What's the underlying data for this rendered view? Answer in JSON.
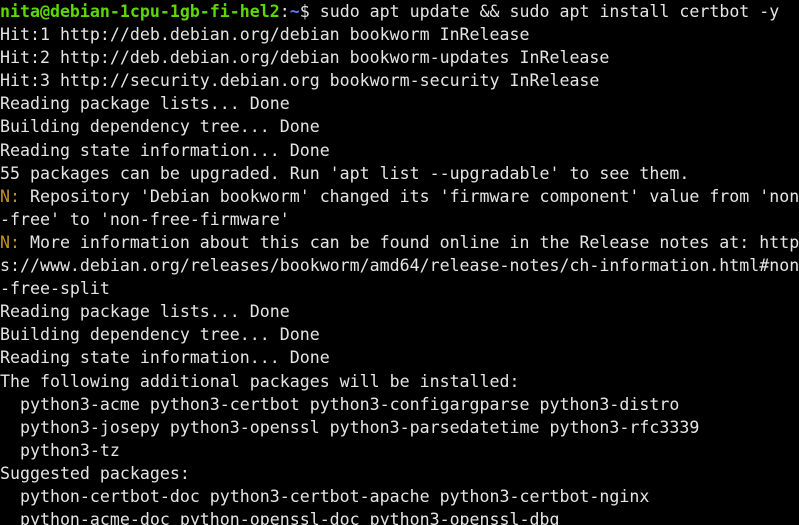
{
  "colors": {
    "background": "#000000",
    "foreground": "#e5e5e5",
    "prompt_user": "#5fd700",
    "prompt_path": "#5c7cfa",
    "notice": "#c0902a"
  },
  "prompt": {
    "user_host": "nita@debian-1cpu-1gb-fi-hel2",
    "colon": ":",
    "path": "~",
    "symbol": "$ ",
    "command": "sudo apt update && sudo apt install certbot -y"
  },
  "output": {
    "l1": "Hit:1 http://deb.debian.org/debian bookworm InRelease",
    "l2": "Hit:2 http://deb.debian.org/debian bookworm-updates InRelease",
    "l3": "Hit:3 http://security.debian.org bookworm-security InRelease",
    "l4": "Reading package lists... Done",
    "l5": "Building dependency tree... Done",
    "l6": "Reading state information... Done",
    "l7": "55 packages can be upgraded. Run 'apt list --upgradable' to see them.",
    "n1_prefix": "N:",
    "n1_text": " Repository 'Debian bookworm' changed its 'firmware component' value from 'non",
    "n1_wrap": "-free' to 'non-free-firmware'",
    "n2_prefix": "N:",
    "n2_text": " More information about this can be found online in the Release notes at: http",
    "n2_wrap1": "s://www.debian.org/releases/bookworm/amd64/release-notes/ch-information.html#non",
    "n2_wrap2": "-free-split",
    "l8": "Reading package lists... Done",
    "l9": "Building dependency tree... Done",
    "l10": "Reading state information... Done",
    "l11": "The following additional packages will be installed:",
    "l12": "  python3-acme python3-certbot python3-configargparse python3-distro",
    "l13": "  python3-josepy python3-openssl python3-parsedatetime python3-rfc3339",
    "l14": "  python3-tz",
    "l15": "Suggested packages:",
    "l16": "  python-certbot-doc python3-certbot-apache python3-certbot-nginx",
    "l17": "  python-acme-doc python-openssl-doc python3-openssl-dbg"
  }
}
